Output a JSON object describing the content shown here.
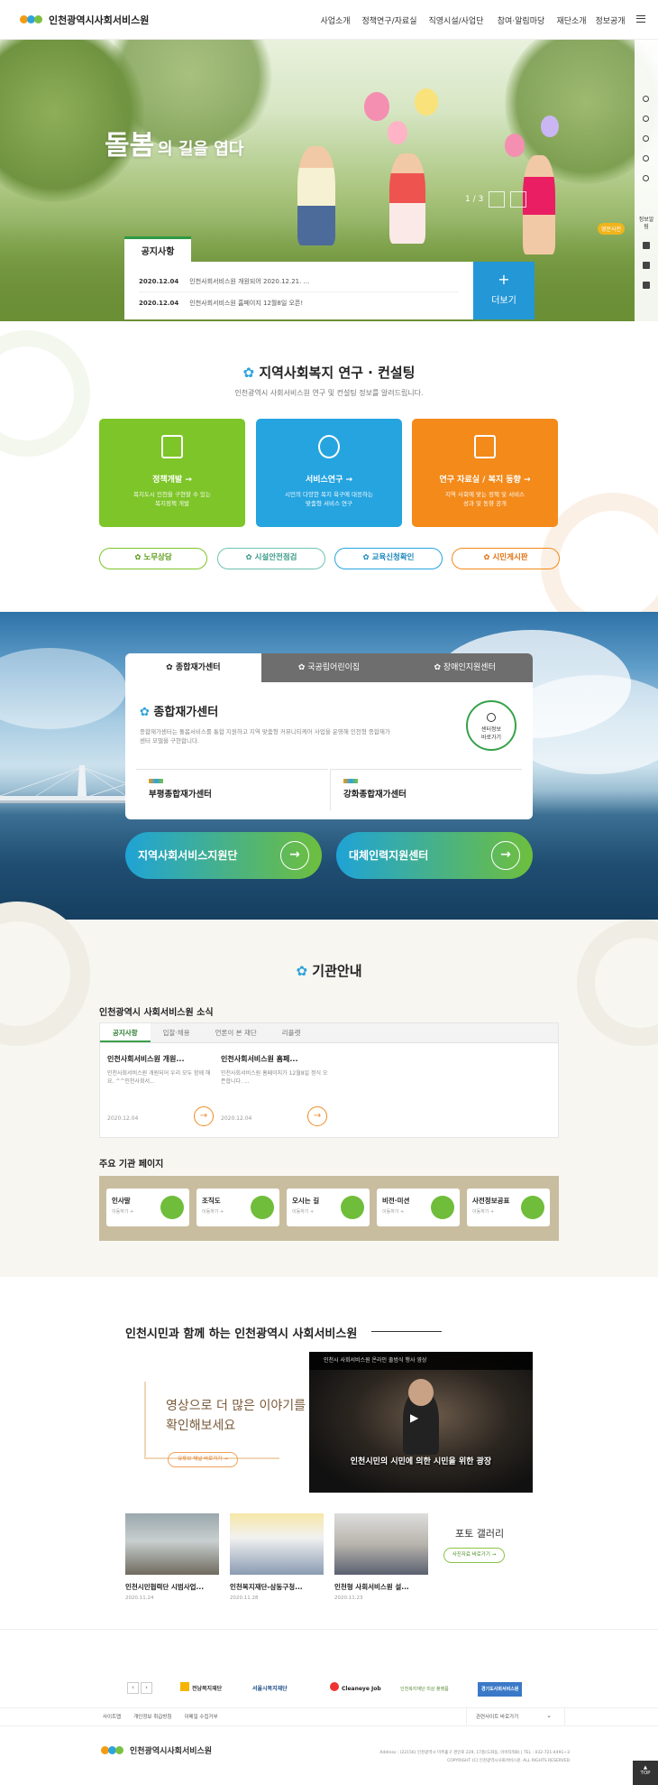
{
  "header": {
    "site_name": "인천광역시사회서비스원",
    "nav": [
      "사업소개",
      "정책연구/자료실",
      "직영시설/사업단",
      "참여·알림마당",
      "재단소개",
      "정보공개"
    ]
  },
  "hero": {
    "title_big": "돌봄",
    "title_rest": "의 길을 엽다",
    "slide_counter": "1 / 3",
    "badge": "영문사전",
    "notice_tab": "공지사항",
    "notices": [
      {
        "date": "2020.12.04",
        "text": "인천사회서비스원 개원되어 2020.12.21. ..."
      },
      {
        "date": "2020.12.04",
        "text": "인천사회서비스원 홈페이지 12월8일 오픈!"
      }
    ],
    "more_label": "더보기",
    "side_label": "정보알림"
  },
  "research": {
    "title": "지역사회복지 연구 · 컨설팅",
    "subtitle": "인천광역시 사회서비스원 연구 및 컨설팅 정보를 알려드립니다.",
    "cards": [
      {
        "title": "정책개발 →",
        "desc1": "복지도시 인천을 구현할 수 있는",
        "desc2": "복지정책 개발"
      },
      {
        "title": "서비스연구 →",
        "desc1": "시민의 다양한 복지 욕구에 대응하는",
        "desc2": "맞춤형 서비스 연구"
      },
      {
        "title": "연구 자료실 / 복지 동향 →",
        "desc1": "지역 사회에 맞는 정책 및 서비스",
        "desc2": "성과 및 동향 공개"
      }
    ],
    "pills": [
      "노무상담",
      "시설안전점검",
      "교육신청확인",
      "시민게시판"
    ]
  },
  "centers": {
    "tabs": [
      "종합재가센터",
      "국공립어린이집",
      "장애인지원센터"
    ],
    "heading": "종합재가센터",
    "desc": "종합재가센터는 돌봄서비스를 통합 지원하고 지역 맞춤형 커뮤니티케어 사업을 운영해 인천형 종합재가센터 모델을 구현합니다.",
    "info_link_1": "센터정보",
    "info_link_2": "바로가기",
    "sub_centers": [
      "부평종합재가센터",
      "강화종합재가센터"
    ],
    "buttons": [
      "지역사회서비스지원단",
      "대체인력지원센터"
    ]
  },
  "institution": {
    "title": "기관안내",
    "news_title": "인천광역시 사회서비스원 소식",
    "news_tabs": [
      "공지사항",
      "입찰·채용",
      "언론이 본 재단",
      "리플렛"
    ],
    "news": [
      {
        "title": "인천사회서비스원 개원...",
        "body": "인천사회서비스원 개원되어 우리 모두 함께 해요. ^^인천사회서...",
        "date": "2020.12.04"
      },
      {
        "title": "인천사회서비스원 홈페...",
        "body": "인천사회서비스원 홈페이지가 12월8일 정식 오픈합니다. ...",
        "date": "2020.12.04"
      }
    ],
    "major_title": "주요 기관 페이지",
    "major_links": [
      {
        "label": "인사말",
        "sub": "이동하기 +"
      },
      {
        "label": "조직도",
        "sub": "이동하기 +"
      },
      {
        "label": "오시는 길",
        "sub": "이동하기 +"
      },
      {
        "label": "비전·미션",
        "sub": "이동하기 +"
      },
      {
        "label": "사전정보공표",
        "sub": "이동하기 +"
      }
    ]
  },
  "video": {
    "title": "인천시민과 함께 하는 인천광역시 사회서비스원",
    "handwriting_1": "영상으로 더 많은 이야기를",
    "handwriting_2": "확인해보세요",
    "more_label": "유튜브 채널 바로가기 →",
    "player_title": "인천시 사회서비스원 온라인 출범식 행사 영상",
    "caption": "인천시민의 시민에 의한 시민을 위한 광장",
    "gallery_title": "포토 갤러리",
    "gallery_more": "사진자료 바로가기 →",
    "gallery": [
      {
        "title": "인천시민협력단 시범사업...",
        "date": "2020.11.24"
      },
      {
        "title": "인천복지재단-삼동구청...",
        "date": "2020.11.28"
      },
      {
        "title": "인천형 사회서비스원 설...",
        "date": "2020.11.23"
      }
    ]
  },
  "partners": {
    "prev": "‹",
    "next": "›",
    "logos": [
      "전남복지재단",
      "서울시복지재단",
      "Cleaneye Job",
      "인천복지재단 미상 플랫폼",
      "경기도사회서비스원"
    ]
  },
  "footer": {
    "links": [
      "사이트맵",
      "개인정보 취급방침",
      "이메일 수집거부"
    ],
    "related": "관련사이트 바로가기",
    "name": "인천광역시사회서비스원",
    "address": "Address : (22156) 인천광역시 미추홀구 경인로 229, 17층(도화동, 아이타워B) | TEL : 032-721-4491~3",
    "copyright": "COPYRIGHT (C) 인천광역시사회서비스원. ALL RIGHTS RESERVED",
    "top": "TOP"
  }
}
